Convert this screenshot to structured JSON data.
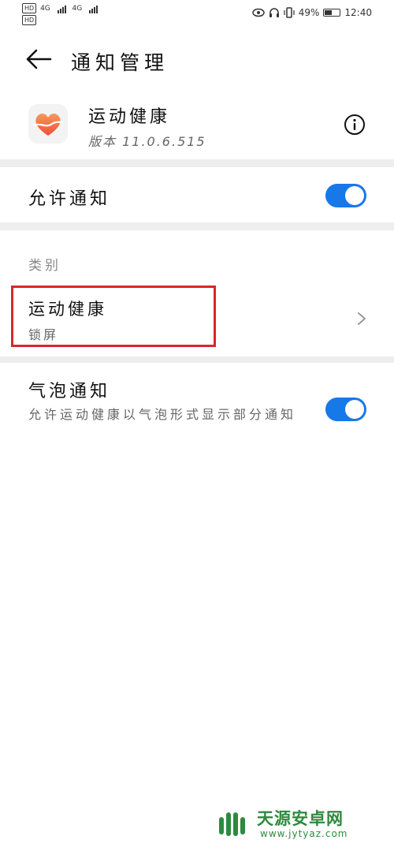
{
  "status_bar": {
    "network_label_1": "HD",
    "network_label_2": "HD",
    "signal_1": "4G",
    "signal_2": "4G",
    "battery_text": "49%",
    "battery_level": 0.49,
    "time": "12:40",
    "icons": [
      "eye-icon",
      "headphones-icon",
      "vibrate-icon",
      "battery-icon"
    ]
  },
  "header": {
    "title": "通知管理",
    "back_icon": "arrow-left-icon"
  },
  "app": {
    "name": "运动健康",
    "version": "版本 11.0.6.515",
    "icon": "heart-icon",
    "info_icon": "info-icon"
  },
  "allow_notifications": {
    "label": "允许通知",
    "enabled": true
  },
  "category_section": {
    "header": "类别",
    "items": [
      {
        "title": "运动健康",
        "subtitle": "锁屏",
        "icon": "chevron-right-icon"
      }
    ]
  },
  "bubble_notifications": {
    "label": "气泡通知",
    "description": "允许运动健康以气泡形式显示部分通知",
    "enabled": true
  },
  "colors": {
    "accent": "#1778e8",
    "highlight_border": "#d7272c",
    "app_icon_orange": "#f26a3d",
    "watermark_green": "#2d8a3e"
  },
  "watermark": {
    "title": "天源安卓网",
    "url": "www.jytyaz.com"
  }
}
